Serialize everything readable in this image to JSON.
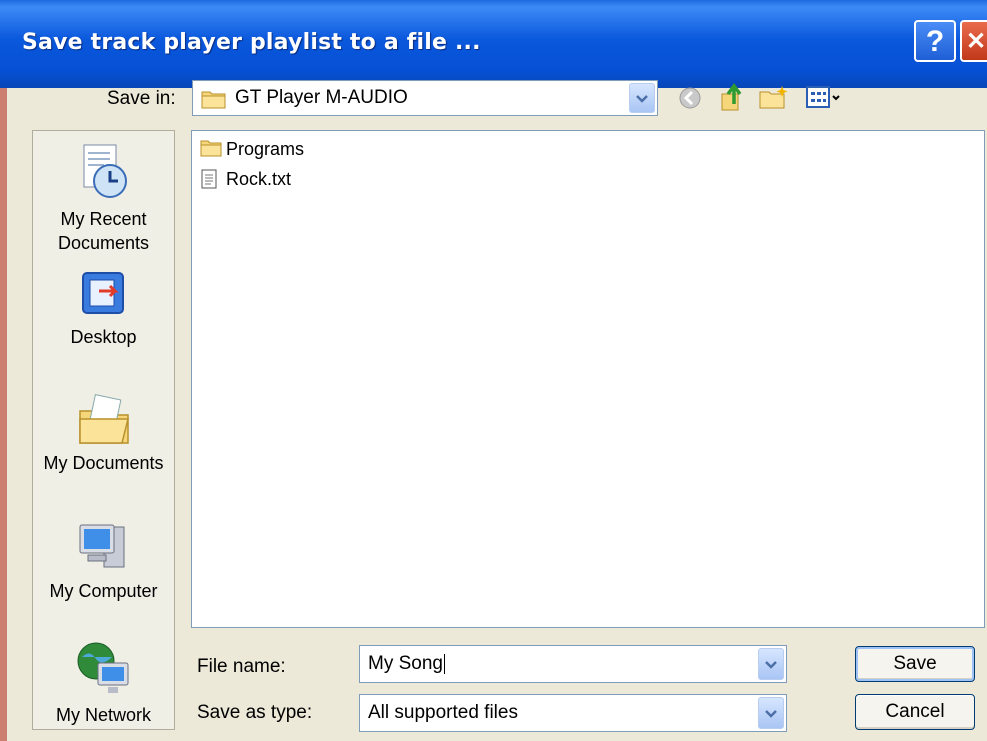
{
  "window": {
    "title": "Save track player playlist to a file ..."
  },
  "titlebar": {
    "help_label": "?",
    "close_label": "✕"
  },
  "save_in": {
    "label": "Save in:",
    "value": "GT Player M-AUDIO"
  },
  "toolbar": {
    "icons": [
      "back-icon",
      "up-folder-icon",
      "new-folder-icon",
      "views-menu-icon"
    ]
  },
  "places": [
    {
      "label": "My Recent\nDocuments",
      "icon": "recent-documents-icon"
    },
    {
      "label": "Desktop",
      "icon": "desktop-icon"
    },
    {
      "label": "My Documents",
      "icon": "my-documents-icon"
    },
    {
      "label": "My Computer",
      "icon": "my-computer-icon"
    },
    {
      "label": "My Network",
      "icon": "my-network-icon"
    }
  ],
  "files": [
    {
      "name": "Programs",
      "type": "folder"
    },
    {
      "name": "Rock.txt",
      "type": "text-file"
    }
  ],
  "file_name": {
    "label": "File name:",
    "value": "My Song"
  },
  "save_as_type": {
    "label": "Save as type:",
    "value": "All supported files"
  },
  "buttons": {
    "save": "Save",
    "cancel": "Cancel"
  }
}
